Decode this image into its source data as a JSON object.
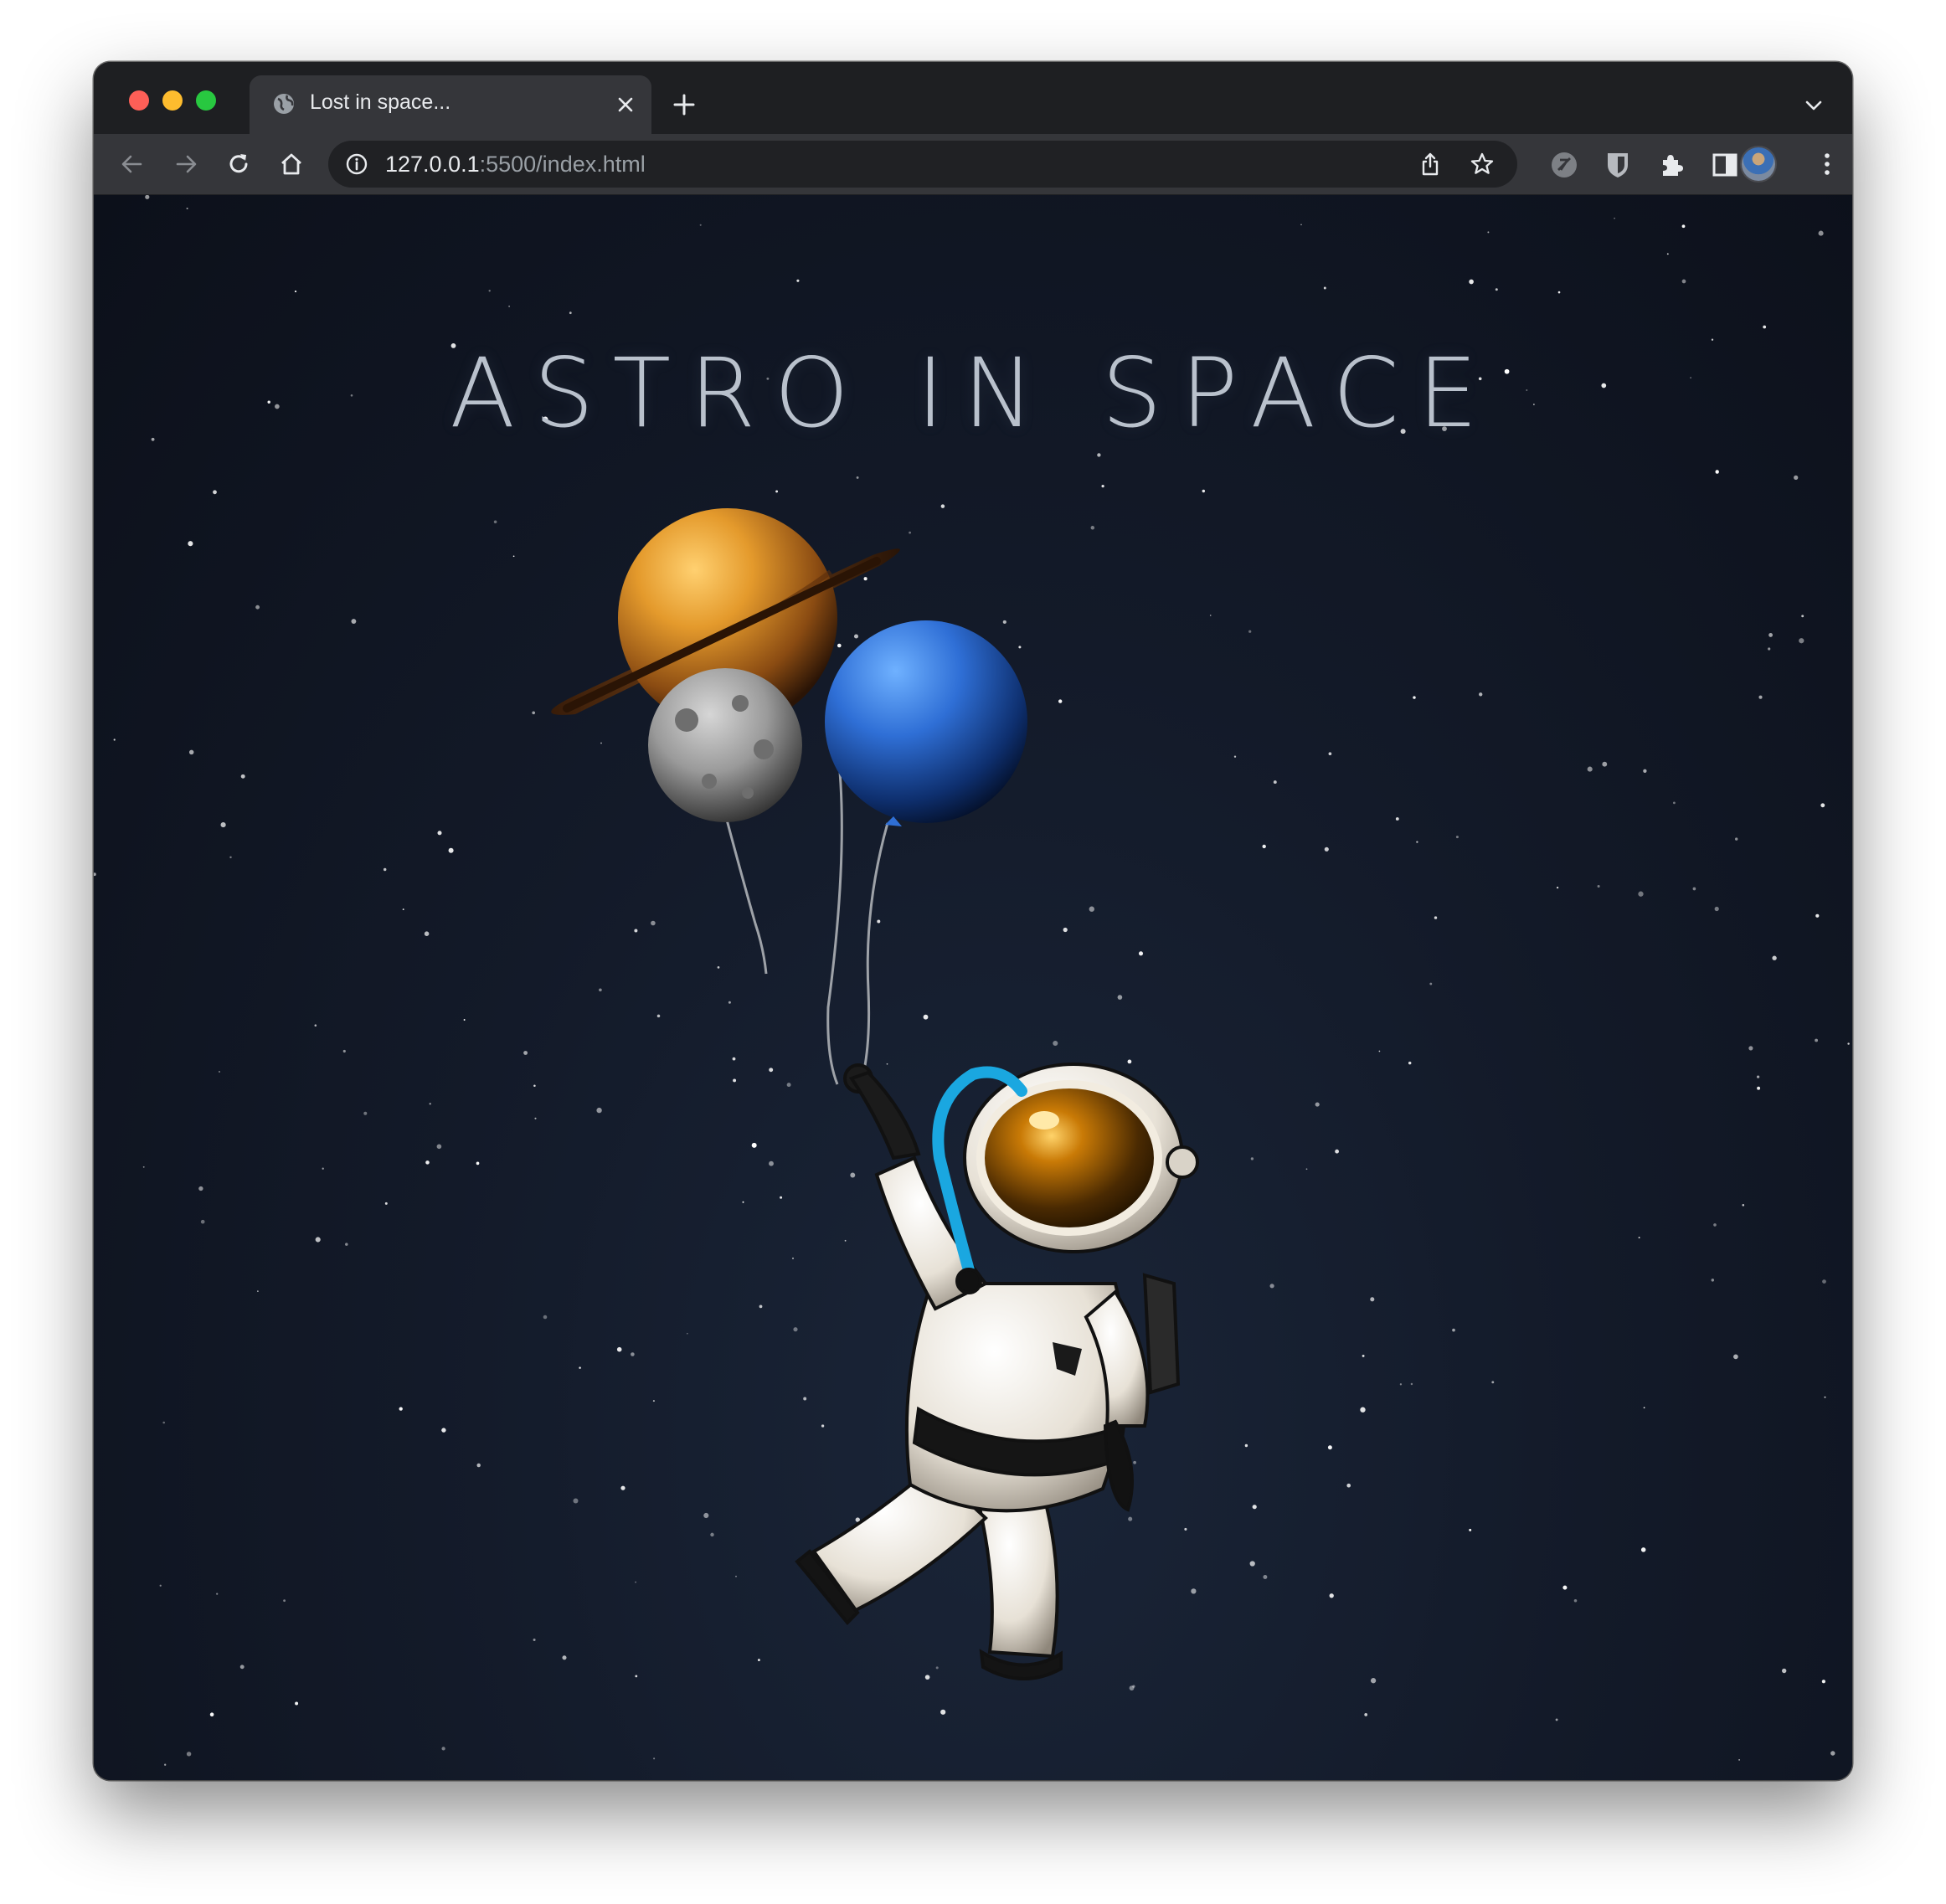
{
  "browser": {
    "tab": {
      "title": "Lost in space...",
      "favicon": "globe-icon"
    },
    "address_bar": {
      "host": "127.0.0.1",
      "path": ":5500/index.html",
      "info_icon": "info-icon"
    },
    "toolbar_icons": [
      "back-arrow-icon",
      "forward-arrow-icon",
      "reload-icon",
      "home-icon",
      "share-icon",
      "bookmark-star-icon",
      "extension-shield-icon",
      "extension-bitwarden-icon",
      "puzzle-icon",
      "side-panel-icon",
      "profile-avatar",
      "more-menu-icon"
    ],
    "colors": {
      "frame": "#1e1f22",
      "toolbar": "#35363a",
      "omnibox": "#202124",
      "text": "#e8eaed"
    }
  },
  "page": {
    "title": "ASTRO IN SPACE",
    "illustration": "astronaut holding planet balloons",
    "balloons": [
      "saturn-balloon",
      "neptune-balloon",
      "moon-balloon"
    ],
    "colors": {
      "background": "#111827",
      "title": "#b9c1cc",
      "saturn": "#e49a2c",
      "neptune": "#2f6fd6",
      "moon": "#9a9a9a",
      "visor": "#c97a06",
      "hose": "#1aa7e0"
    }
  }
}
